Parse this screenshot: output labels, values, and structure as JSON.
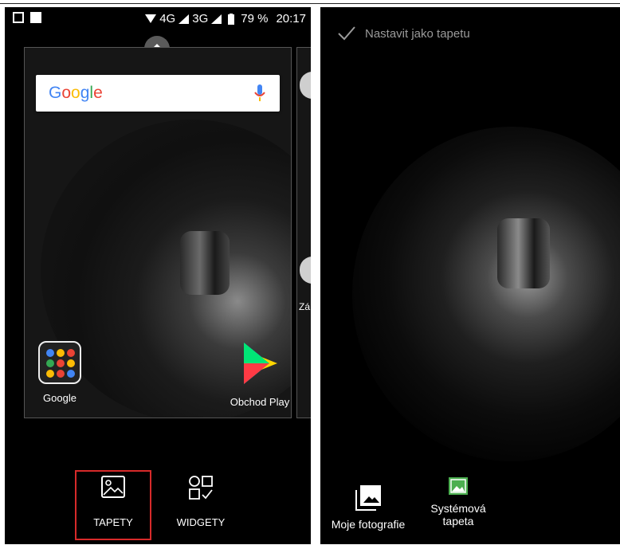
{
  "left": {
    "status_bar": {
      "network": "4G",
      "network2": "3G",
      "battery": "79 %",
      "time": "20:17"
    },
    "search": {
      "brand": [
        "G",
        "o",
        "o",
        "g",
        "l",
        "e"
      ],
      "brand_colors": [
        "#4285F4",
        "#EA4335",
        "#FBBC05",
        "#4285F4",
        "#34A853",
        "#EA4335"
      ]
    },
    "apps": [
      {
        "label": "Google"
      },
      {
        "label": "Obchod Play"
      }
    ],
    "partial_label": "Zá",
    "bottom": {
      "tapety_label": "TAPETY",
      "widgety_label": "WIDGETY"
    },
    "highlight_color": "#d72a2a"
  },
  "right": {
    "header_label": "Nastavit jako tapetu",
    "buttons": {
      "photos_label": "Moje fotografie",
      "system_label_1": "Systémová",
      "system_label_2": "tapeta"
    }
  }
}
